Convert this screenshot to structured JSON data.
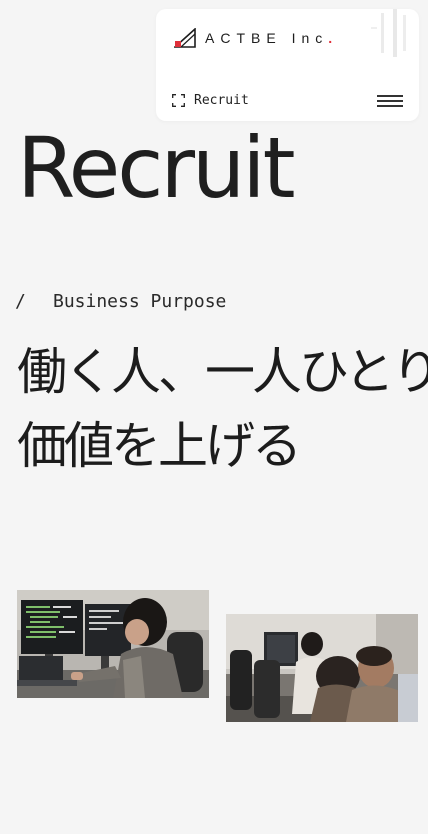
{
  "header": {
    "logo_text": "ACTBE Inc",
    "logo_dot": ".",
    "current_page": "Recruit",
    "icons": {
      "logo": "actbe-logo-mark",
      "current_page": "bracket-frame-icon",
      "menu": "hamburger-menu-icon"
    }
  },
  "hero": {
    "title": "Recruit"
  },
  "section": {
    "slash": "/",
    "label": "Business Purpose"
  },
  "headline": {
    "line1": "働く人、一人ひとりの",
    "line2": "価値を上げる"
  },
  "photos": [
    {
      "name": "office-photo-developer-at-monitors"
    },
    {
      "name": "office-photo-team-at-desks"
    }
  ],
  "colors": {
    "background": "#f5f5f5",
    "accent": "#e0303a",
    "text": "#1f1f1f"
  }
}
